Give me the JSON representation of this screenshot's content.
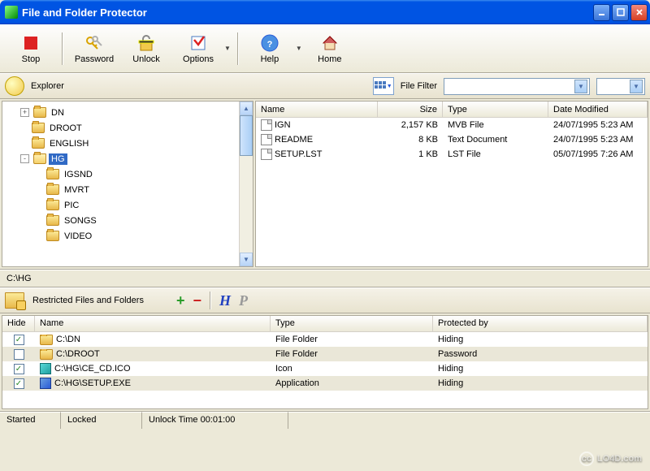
{
  "window": {
    "title": "File and Folder Protector"
  },
  "toolbar": {
    "stop": "Stop",
    "password": "Password",
    "unlock": "Unlock",
    "options": "Options",
    "help": "Help",
    "home": "Home"
  },
  "explorerbar": {
    "label": "Explorer",
    "filter_label": "File Filter"
  },
  "tree": {
    "items": [
      {
        "label": "DN",
        "depth": 0,
        "expander": "+",
        "selected": false
      },
      {
        "label": "DROOT",
        "depth": 0,
        "expander": "",
        "selected": false
      },
      {
        "label": "ENGLISH",
        "depth": 0,
        "expander": "",
        "selected": false
      },
      {
        "label": "HG",
        "depth": 0,
        "expander": "-",
        "selected": true
      },
      {
        "label": "IGSND",
        "depth": 1,
        "expander": "",
        "selected": false
      },
      {
        "label": "MVRT",
        "depth": 1,
        "expander": "",
        "selected": false
      },
      {
        "label": "PIC",
        "depth": 1,
        "expander": "",
        "selected": false
      },
      {
        "label": "SONGS",
        "depth": 1,
        "expander": "",
        "selected": false
      },
      {
        "label": "VIDEO",
        "depth": 1,
        "expander": "",
        "selected": false
      }
    ]
  },
  "filelist": {
    "columns": {
      "name": "Name",
      "size": "Size",
      "type": "Type",
      "modified": "Date Modified"
    },
    "colwidths": {
      "name": 150,
      "size": 80,
      "type": 130,
      "modified": 150
    },
    "rows": [
      {
        "name": "IGN",
        "size": "2,157 KB",
        "type": "MVB File",
        "modified": "24/07/1995 5:23 AM"
      },
      {
        "name": "README",
        "size": "8 KB",
        "type": "Text Document",
        "modified": "24/07/1995 5:23 AM"
      },
      {
        "name": "SETUP.LST",
        "size": "1 KB",
        "type": "LST File",
        "modified": "05/07/1995 7:26 AM"
      }
    ]
  },
  "path": "C:\\HG",
  "restricted": {
    "label": "Restricted Files and Folders",
    "columns": {
      "hide": "Hide",
      "name": "Name",
      "type": "Type",
      "protected": "Protected by"
    },
    "colwidths": {
      "hide": 40,
      "name": 290,
      "type": 200,
      "protected": 200
    },
    "rows": [
      {
        "hide": true,
        "name": "C:\\DN",
        "type": "File Folder",
        "protected": "Hiding",
        "icon": "folder",
        "sel": false
      },
      {
        "hide": false,
        "name": "C:\\DROOT",
        "type": "File Folder",
        "protected": "Password",
        "icon": "folder",
        "sel": true
      },
      {
        "hide": true,
        "name": "C:\\HG\\CE_CD.ICO",
        "type": "Icon",
        "protected": "Hiding",
        "icon": "ico",
        "sel": false
      },
      {
        "hide": true,
        "name": "C:\\HG\\SETUP.EXE",
        "type": "Application",
        "protected": "Hiding",
        "icon": "app",
        "sel": true
      }
    ]
  },
  "statusbar": {
    "started": "Started",
    "locked": "Locked",
    "unlock_time": "Unlock Time 00:01:00"
  },
  "watermark": "LO4D.com"
}
